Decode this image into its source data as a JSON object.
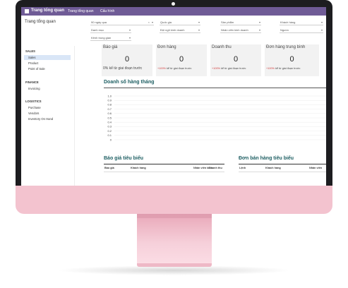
{
  "topbar": {
    "app_title": "Trang tổng quan",
    "nav": [
      "Trang tổng quan",
      "Cấu hình"
    ]
  },
  "page_title": "Trang tổng quan",
  "filters": [
    {
      "label": "90 ngày qua",
      "clearable": true
    },
    {
      "label": "Quốc gia"
    },
    {
      "label": "Sản phẩm"
    },
    {
      "label": "Khách hàng"
    },
    {
      "label": "Danh mục"
    },
    {
      "label": "Đội ngũ kinh doanh"
    },
    {
      "label": "Nhân viên kinh doanh"
    },
    {
      "label": "Nguồn"
    },
    {
      "label": "Kênh trung gian"
    }
  ],
  "sidebar": {
    "sections": [
      {
        "title": "SALES",
        "items": [
          {
            "label": "Sales",
            "active": true
          },
          {
            "label": "Product"
          },
          {
            "label": "Point of Sale"
          }
        ]
      },
      {
        "title": "FINANCE",
        "items": [
          {
            "label": "Invoicing"
          }
        ]
      },
      {
        "title": "LOGISTICS",
        "items": [
          {
            "label": "Purchase"
          },
          {
            "label": "Vendors"
          },
          {
            "label": "Inventory On Hand"
          }
        ]
      }
    ]
  },
  "kpis": [
    {
      "title": "Báo giá",
      "value": "0",
      "change": "0%",
      "change_text": "kể từ giai đoạn trước",
      "change_color": "#444444"
    },
    {
      "title": "Đơn hàng",
      "value": "0",
      "change": "+100%",
      "change_text": "kể từ giai đoạn trước",
      "change_color": "#d03a3a"
    },
    {
      "title": "Doanh thu",
      "value": "0",
      "change": "+100%",
      "change_text": "kể từ giai đoạn trước",
      "change_color": "#d03a3a"
    },
    {
      "title": "Đơn hàng trung bình",
      "value": "0",
      "change": "+100%",
      "change_text": "kể từ giai đoạn trước",
      "change_color": "#d03a3a"
    }
  ],
  "monthly_sales": {
    "title": "Doanh số hàng tháng"
  },
  "chart_data": {
    "type": "line",
    "title": "Doanh số hàng tháng",
    "xlabel": "",
    "ylabel": "",
    "ylim": [
      0,
      1.0
    ],
    "yticks": [
      "1.0",
      "0.9",
      "0.8",
      "0.7",
      "0.6",
      "0.5",
      "0.4",
      "0.3",
      "0.2",
      "0.1",
      "0"
    ],
    "grid": true,
    "series": []
  },
  "top_quotes": {
    "title": "Báo giá tiêu biểu",
    "columns": [
      "Báo giá",
      "Khách hàng",
      "Nhân viên kinh",
      "Doanh thu"
    ]
  },
  "top_orders": {
    "title": "Đơn bán hàng tiêu biểu",
    "columns": [
      "Lệnh",
      "Khách hàng",
      "Nhân viên"
    ]
  },
  "colors": {
    "brand": "#6f5b96",
    "accent": "#1d5e62",
    "active": "#d9e6f7",
    "chin": "#f3c3cf"
  }
}
